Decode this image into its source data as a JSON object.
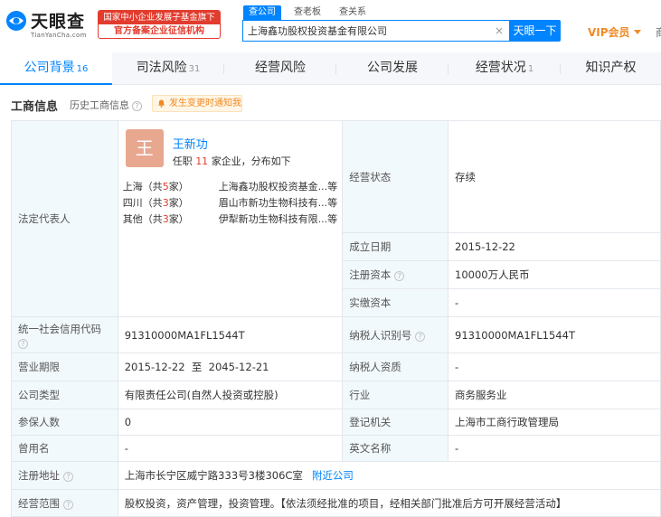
{
  "header": {
    "logo_name": "天眼查",
    "logo_domain": "TianYanCha.com",
    "badge_line1": "国家中小企业发展子基金旗下",
    "badge_line2": "官方备案企业征信机构",
    "search_tabs": [
      "查公司",
      "查老板",
      "查关系"
    ],
    "search_value": "上海鑫功股权投资基金有限公司",
    "search_clear": "×",
    "search_button": "天眼一下",
    "vip_label": "VIP会员",
    "edge_text": "商"
  },
  "nav": {
    "tabs": [
      {
        "label": "公司背景",
        "count": "16"
      },
      {
        "label": "司法风险",
        "count": "31"
      },
      {
        "label": "经营风险",
        "count": ""
      },
      {
        "label": "公司发展",
        "count": ""
      },
      {
        "label": "经营状况",
        "count": "1"
      },
      {
        "label": "知识产权",
        "count": ""
      }
    ]
  },
  "section": {
    "title": "工商信息",
    "history": "历史工商信息",
    "notify": "发生变更时通知我"
  },
  "legal_rep": {
    "label": "法定代表人",
    "avatar": "王",
    "name": "王新功",
    "summary_prefix": "任职",
    "summary_count": "11",
    "summary_suffix": "家企业，分布如下",
    "regions": [
      {
        "region": "上海",
        "count": "5",
        "company": "上海鑫功股权投资基金...等"
      },
      {
        "region": "四川",
        "count": "3",
        "company": "眉山市新功生物科技有...等"
      },
      {
        "region": "其他",
        "count": "3",
        "company": "伊犁新功生物科技有限...等"
      }
    ],
    "region_prefix": "（共",
    "region_suffix": "家）"
  },
  "fields": {
    "status_label": "经营状态",
    "status_value": "存续",
    "founded_label": "成立日期",
    "founded_value": "2015-12-22",
    "capital_label": "注册资本",
    "capital_value": "10000万人民币",
    "paid_label": "实缴资本",
    "paid_value": "-",
    "credit_code_label": "统一社会信用代码",
    "credit_code_value": "91310000MA1FL1544T",
    "taxpayer_id_label": "纳税人识别号",
    "taxpayer_id_value": "91310000MA1FL1544T",
    "term_label": "营业期限",
    "term_value": "2015-12-22  至  2045-12-21",
    "taxpayer_qual_label": "纳税人资质",
    "taxpayer_qual_value": "-",
    "type_label": "公司类型",
    "type_value": "有限责任公司(自然人投资或控股)",
    "industry_label": "行业",
    "industry_value": "商务服务业",
    "insured_label": "参保人数",
    "insured_value": "0",
    "authority_label": "登记机关",
    "authority_value": "上海市工商行政管理局",
    "former_name_label": "曾用名",
    "former_name_value": "-",
    "english_name_label": "英文名称",
    "english_name_value": "-",
    "address_label": "注册地址",
    "address_value": "上海市长宁区威宁路333号3楼306C室",
    "address_link": "附近公司",
    "scope_label": "经营范围",
    "scope_value": "股权投资，资产管理，投资管理。【依法须经批准的项目，经相关部门批准后方可开展经营活动】"
  },
  "colors": {
    "brand_blue": "#0084ff",
    "badge_red": "#e23c2e",
    "vip_orange": "#f08a24",
    "label_bg": "#f2f9fc",
    "avatar_bg": "#e8a78f"
  }
}
